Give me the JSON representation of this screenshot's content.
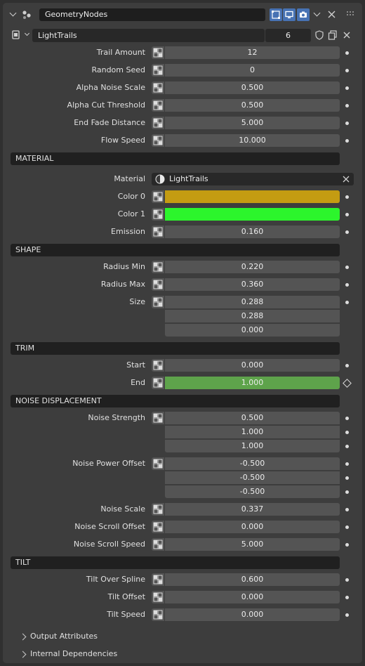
{
  "header": {
    "modifier_name": "GeometryNodes",
    "node_group": "LightTrails",
    "users": "6"
  },
  "inputs": [
    {
      "label": "Trail Amount",
      "value": "12"
    },
    {
      "label": "Random Seed",
      "value": "0"
    },
    {
      "label": "Alpha Noise Scale",
      "value": "0.500"
    },
    {
      "label": "Alpha Cut Threshold",
      "value": "0.500"
    },
    {
      "label": "End Fade Distance",
      "value": "5.000"
    },
    {
      "label": "Flow Speed",
      "value": "10.000"
    }
  ],
  "material_section": {
    "title": "MATERIAL",
    "material_label": "Material",
    "material_value": "LightTrails",
    "color0_label": "Color 0",
    "color0_hex": "#c49c12",
    "color1_label": "Color 1",
    "color1_hex": "#2cf52c",
    "emission_label": "Emission",
    "emission_value": "0.160"
  },
  "shape_section": {
    "title": "SHAPE",
    "radius_min_label": "Radius Min",
    "radius_min_value": "0.220",
    "radius_max_label": "Radius Max",
    "radius_max_value": "0.360",
    "size_label": "Size",
    "size_values": [
      "0.288",
      "0.288",
      "0.000"
    ]
  },
  "trim_section": {
    "title": "TRIM",
    "start_label": "Start",
    "start_value": "0.000",
    "end_label": "End",
    "end_value": "1.000"
  },
  "noise_section": {
    "title": "NOISE DISPLACEMENT",
    "strength_label": "Noise Strength",
    "strength_values": [
      "0.500",
      "1.000",
      "1.000"
    ],
    "power_label": "Noise Power Offset",
    "power_values": [
      "-0.500",
      "-0.500",
      "-0.500"
    ],
    "scale_label": "Noise Scale",
    "scale_value": "0.337",
    "scroll_offset_label": "Noise Scroll Offset",
    "scroll_offset_value": "0.000",
    "scroll_speed_label": "Noise Scroll Speed",
    "scroll_speed_value": "5.000"
  },
  "tilt_section": {
    "title": "TILT",
    "over_spline_label": "Tilt Over Spline",
    "over_spline_value": "0.600",
    "offset_label": "Tilt Offset",
    "offset_value": "0.000",
    "speed_label": "Tilt Speed",
    "speed_value": "0.000"
  },
  "subpanels": {
    "output_attributes": "Output Attributes",
    "internal_dependencies": "Internal Dependencies"
  }
}
